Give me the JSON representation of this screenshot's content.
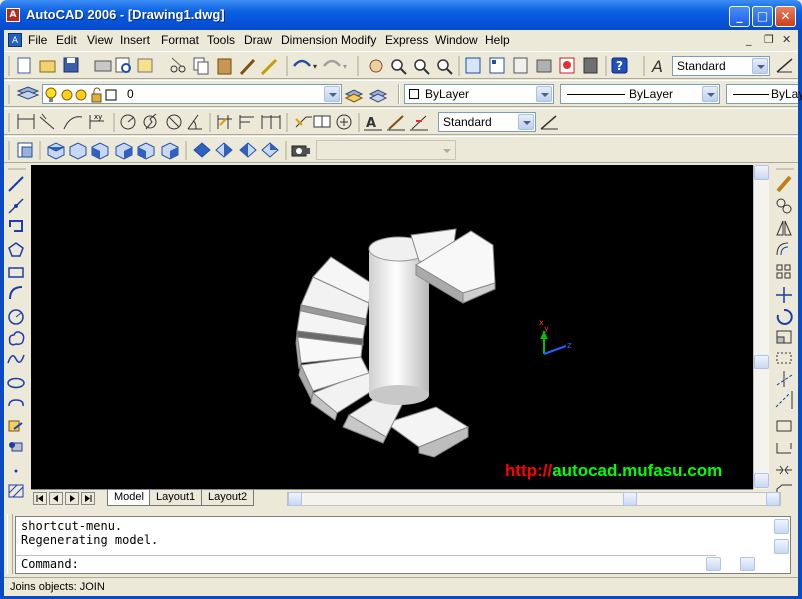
{
  "window": {
    "title": "AutoCAD 2006 - [Drawing1.dwg]",
    "minimize_label": "_",
    "maximize_label": "□",
    "close_label": "✕"
  },
  "menu": {
    "items": [
      "File",
      "Edit",
      "View",
      "Insert",
      "Format",
      "Tools",
      "Draw",
      "Dimension",
      "Modify",
      "Express",
      "Window",
      "Help"
    ],
    "mdi_minimize": "_",
    "mdi_restore": "❐",
    "mdi_close": "✕"
  },
  "toolbars": {
    "text_style": "Standard",
    "layer": "0",
    "color": "ByLayer",
    "linetype": "ByLayer",
    "lineweight": "ByLay",
    "dim_style": "Standard",
    "view_combo": ""
  },
  "viewport": {
    "watermark_prefix": "http://",
    "watermark_domain": "autocad.mufasu.com",
    "watermark_prefix_color": "#ff0000",
    "watermark_domain_color": "#00ff00",
    "ucs_x_label": "x",
    "ucs_y_label": "y",
    "ucs_z_label": "z"
  },
  "layout_tabs": [
    "Model",
    "Layout1",
    "Layout2"
  ],
  "active_tab": "Model",
  "command": {
    "lines": [
      "shortcut-menu.",
      "Regenerating model."
    ],
    "prompt": "Command:"
  },
  "status": {
    "text": "Joins objects:  JOIN"
  },
  "colors": {
    "title_bar": "#0a5fe0",
    "viewport_bg": "#000000",
    "chrome": "#ece9d8"
  }
}
